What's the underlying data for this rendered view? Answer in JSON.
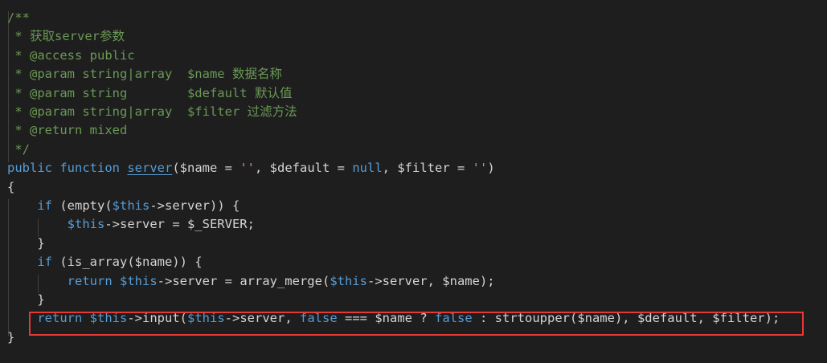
{
  "editor": {
    "lines": [
      [
        {
          "t": "/**",
          "c": "comment"
        }
      ],
      [
        {
          "t": " * 获取server参数",
          "c": "comment"
        }
      ],
      [
        {
          "t": " * @access public",
          "c": "comment"
        }
      ],
      [
        {
          "t": " * @param string|array  $name 数据名称",
          "c": "comment"
        }
      ],
      [
        {
          "t": " * @param string        $default 默认值",
          "c": "comment"
        }
      ],
      [
        {
          "t": " * @param string|array  $filter 过滤方法",
          "c": "comment"
        }
      ],
      [
        {
          "t": " * @return mixed",
          "c": "comment"
        }
      ],
      [
        {
          "t": " */",
          "c": "comment"
        }
      ],
      [
        {
          "t": "public",
          "c": "keyword"
        },
        {
          "t": " ",
          "c": "text"
        },
        {
          "t": "function",
          "c": "keyword"
        },
        {
          "t": " ",
          "c": "text"
        },
        {
          "t": "server",
          "c": "func"
        },
        {
          "t": "($name = ",
          "c": "text"
        },
        {
          "t": "''",
          "c": "string"
        },
        {
          "t": ", $default = ",
          "c": "text"
        },
        {
          "t": "null",
          "c": "keyword"
        },
        {
          "t": ", $filter = ",
          "c": "text"
        },
        {
          "t": "''",
          "c": "string"
        },
        {
          "t": ")",
          "c": "text"
        }
      ],
      [
        {
          "t": "{",
          "c": "text"
        }
      ],
      [
        {
          "t": "    ",
          "c": "text"
        },
        {
          "t": "if",
          "c": "keyword"
        },
        {
          "t": " (empty(",
          "c": "text"
        },
        {
          "t": "$this",
          "c": "this"
        },
        {
          "t": "->server)) {",
          "c": "text"
        }
      ],
      [
        {
          "t": "        ",
          "c": "text"
        },
        {
          "t": "$this",
          "c": "this"
        },
        {
          "t": "->server = $_SERVER;",
          "c": "text"
        }
      ],
      [
        {
          "t": "    }",
          "c": "text"
        }
      ],
      [
        {
          "t": "    ",
          "c": "text"
        },
        {
          "t": "if",
          "c": "keyword"
        },
        {
          "t": " (is_array($name)) {",
          "c": "text"
        }
      ],
      [
        {
          "t": "        ",
          "c": "text"
        },
        {
          "t": "return",
          "c": "keyword"
        },
        {
          "t": " ",
          "c": "text"
        },
        {
          "t": "$this",
          "c": "this"
        },
        {
          "t": "->server = array_merge(",
          "c": "text"
        },
        {
          "t": "$this",
          "c": "this"
        },
        {
          "t": "->server, $name);",
          "c": "text"
        }
      ],
      [
        {
          "t": "    }",
          "c": "text"
        }
      ],
      [
        {
          "t": "    ",
          "c": "text"
        },
        {
          "t": "return",
          "c": "keyword"
        },
        {
          "t": " ",
          "c": "text"
        },
        {
          "t": "$this",
          "c": "this"
        },
        {
          "t": "->input(",
          "c": "text"
        },
        {
          "t": "$this",
          "c": "this"
        },
        {
          "t": "->server, ",
          "c": "text"
        },
        {
          "t": "false",
          "c": "keyword"
        },
        {
          "t": " === $name ? ",
          "c": "text"
        },
        {
          "t": "false",
          "c": "keyword"
        },
        {
          "t": " : strtoupper($name), $default, $filter);",
          "c": "text"
        }
      ],
      [
        {
          "t": "}",
          "c": "text"
        }
      ]
    ]
  },
  "colors": {
    "background": "#1e1e1e",
    "comment": "#6a9955",
    "keyword": "#569cd6",
    "text": "#d4d4d4",
    "string": "#ce9178",
    "highlight_border": "#e53935"
  }
}
